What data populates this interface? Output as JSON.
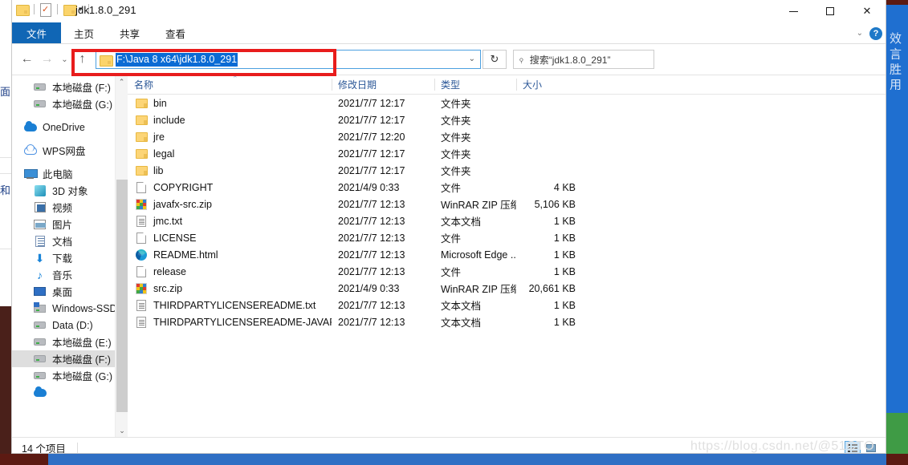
{
  "window": {
    "title": "jdk1.8.0_291",
    "quick_access": [
      "folder-icon",
      "properties-icon",
      "new-folder-icon",
      "customize-caret"
    ],
    "controls": {
      "minimize": "—",
      "maximize": "□",
      "close": "✕"
    }
  },
  "ribbon": {
    "tabs": [
      {
        "label": "文件",
        "active": true
      },
      {
        "label": "主页",
        "active": false
      },
      {
        "label": "共享",
        "active": false
      },
      {
        "label": "查看",
        "active": false
      }
    ],
    "collapse_caret": "⌄",
    "help_label": "?"
  },
  "address": {
    "back": "←",
    "forward": "→",
    "recent": "⌄",
    "up": "↑",
    "path_text": "F:\\Java 8 x64\\jdk1.8.0_291",
    "dropdown_caret": "⌄",
    "refresh": "↻"
  },
  "search": {
    "icon": "⌕",
    "placeholder": "搜索“jdk1.8.0_291”"
  },
  "sidebar": {
    "items": [
      {
        "label": "本地磁盘 (F:)",
        "icon": "drive-icon",
        "indent": 1,
        "selected": false
      },
      {
        "label": "本地磁盘 (G:)",
        "icon": "drive-icon",
        "indent": 1,
        "selected": false
      },
      {
        "label": "OneDrive",
        "icon": "onedrive-icon",
        "indent": 0,
        "selected": false,
        "gap_before": true
      },
      {
        "label": "WPS网盘",
        "icon": "wps-icon",
        "indent": 0,
        "selected": false,
        "gap_before": true
      },
      {
        "label": "此电脑",
        "icon": "pc-icon",
        "indent": 0,
        "selected": false,
        "gap_before": true
      },
      {
        "label": "3D 对象",
        "icon": "3d-objects-icon",
        "indent": 1,
        "selected": false
      },
      {
        "label": "视频",
        "icon": "videos-icon",
        "indent": 1,
        "selected": false
      },
      {
        "label": "图片",
        "icon": "pictures-icon",
        "indent": 1,
        "selected": false
      },
      {
        "label": "文档",
        "icon": "documents-icon",
        "indent": 1,
        "selected": false
      },
      {
        "label": "下载",
        "icon": "downloads-icon",
        "indent": 1,
        "selected": false
      },
      {
        "label": "音乐",
        "icon": "music-icon",
        "indent": 1,
        "selected": false
      },
      {
        "label": "桌面",
        "icon": "desktop-icon",
        "indent": 1,
        "selected": false
      },
      {
        "label": "Windows-SSD",
        "icon": "ssd-icon",
        "indent": 1,
        "selected": false
      },
      {
        "label": "Data (D:)",
        "icon": "drive-icon",
        "indent": 1,
        "selected": false
      },
      {
        "label": "本地磁盘 (E:)",
        "icon": "drive-icon",
        "indent": 1,
        "selected": false
      },
      {
        "label": "本地磁盘 (F:)",
        "icon": "drive-icon",
        "indent": 1,
        "selected": true
      },
      {
        "label": "本地磁盘 (G:)",
        "icon": "drive-icon",
        "indent": 1,
        "selected": false
      }
    ],
    "scroll_up": "⌃",
    "scroll_down": "⌄"
  },
  "filelist": {
    "columns": [
      {
        "label": "名称",
        "sorted": "asc"
      },
      {
        "label": "修改日期",
        "sorted": ""
      },
      {
        "label": "类型",
        "sorted": ""
      },
      {
        "label": "大小",
        "sorted": ""
      }
    ],
    "sort_caret": "⌃",
    "rows": [
      {
        "name": "bin",
        "date": "2021/7/7 12:17",
        "type": "文件夹",
        "size": "",
        "icon": "folder-icon"
      },
      {
        "name": "include",
        "date": "2021/7/7 12:17",
        "type": "文件夹",
        "size": "",
        "icon": "folder-icon"
      },
      {
        "name": "jre",
        "date": "2021/7/7 12:20",
        "type": "文件夹",
        "size": "",
        "icon": "folder-icon"
      },
      {
        "name": "legal",
        "date": "2021/7/7 12:17",
        "type": "文件夹",
        "size": "",
        "icon": "folder-icon"
      },
      {
        "name": "lib",
        "date": "2021/7/7 12:17",
        "type": "文件夹",
        "size": "",
        "icon": "folder-icon"
      },
      {
        "name": "COPYRIGHT",
        "date": "2021/4/9 0:33",
        "type": "文件",
        "size": "4 KB",
        "icon": "file-icon"
      },
      {
        "name": "javafx-src.zip",
        "date": "2021/7/7 12:13",
        "type": "WinRAR ZIP 压缩...",
        "size": "5,106 KB",
        "icon": "zip-icon"
      },
      {
        "name": "jmc.txt",
        "date": "2021/7/7 12:13",
        "type": "文本文档",
        "size": "1 KB",
        "icon": "text-icon"
      },
      {
        "name": "LICENSE",
        "date": "2021/7/7 12:13",
        "type": "文件",
        "size": "1 KB",
        "icon": "file-icon"
      },
      {
        "name": "README.html",
        "date": "2021/7/7 12:13",
        "type": "Microsoft Edge ...",
        "size": "1 KB",
        "icon": "edge-icon"
      },
      {
        "name": "release",
        "date": "2021/7/7 12:13",
        "type": "文件",
        "size": "1 KB",
        "icon": "file-icon"
      },
      {
        "name": "src.zip",
        "date": "2021/4/9 0:33",
        "type": "WinRAR ZIP 压缩...",
        "size": "20,661 KB",
        "icon": "zip-icon"
      },
      {
        "name": "THIRDPARTYLICENSEREADME.txt",
        "date": "2021/7/7 12:13",
        "type": "文本文档",
        "size": "1 KB",
        "icon": "text-icon"
      },
      {
        "name": "THIRDPARTYLICENSEREADME-JAVAF...",
        "date": "2021/7/7 12:13",
        "type": "文本文档",
        "size": "1 KB",
        "icon": "text-icon"
      }
    ]
  },
  "statusbar": {
    "item_count": "14 个项目",
    "view_details": "details-view-icon",
    "view_thumbnails": "thumbnail-view-icon"
  },
  "annotation": {
    "type": "red-rectangle-highlight",
    "color": "#e81c1c",
    "target": "address-bar"
  },
  "watermark": {
    "text": "https://blog.csdn.net/@51CTO"
  },
  "background": {
    "left_text_1": "面",
    "left_text_2": "和",
    "right_glyphs": "效 言 胜 用"
  },
  "colors": {
    "accent": "#1066b5",
    "selection": "#0a6bd4",
    "annotation": "#e81c1c",
    "header_text": "#2b5797"
  }
}
